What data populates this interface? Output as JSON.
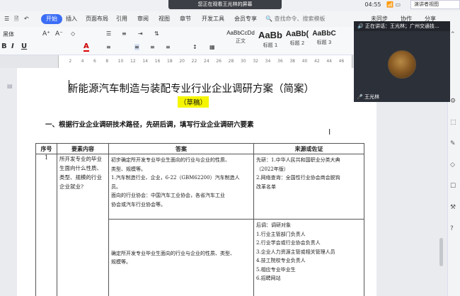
{
  "window": {
    "share_banner": "您正在观看王光林的屏幕",
    "time": "04:55",
    "presenter_view": "演讲者视图"
  },
  "menu": {
    "start": "开始",
    "items": [
      "插入",
      "页面布局",
      "引用",
      "审阅",
      "视图",
      "章节",
      "开发工具",
      "会员专享"
    ],
    "search": "查找命令、搜索模板",
    "right": [
      "未同步",
      "协作",
      "分享"
    ]
  },
  "ribbon": {
    "font_name": "黑体",
    "formats": [
      "B",
      "I",
      "U",
      "A"
    ],
    "styles": [
      {
        "sample": "AaBbCcDd",
        "name": "正文"
      },
      {
        "sample": "AaBb",
        "name": "标题 1"
      },
      {
        "sample": "AaBb(",
        "name": "标题 2"
      },
      {
        "sample": "AaBbC",
        "name": "标题 3"
      }
    ]
  },
  "ruler": {
    "numbers": [
      "2",
      "4",
      "6",
      "8",
      "10",
      "12",
      "14",
      "16",
      "18",
      "20",
      "22",
      "24",
      "26",
      "28",
      "30",
      "32",
      "34",
      "36",
      "38",
      "40",
      "42",
      "44",
      "46"
    ]
  },
  "doc": {
    "title": "新能源汽车制造与装配专业行业企业调研方案（简案）",
    "draft": "（草稿）",
    "section_heading": "一、根据行业企业调研技术路径，先研后调，填写行业企业调研六要素",
    "table": {
      "headers": [
        "序号",
        "要素内容",
        "答案",
        "来源或佐证"
      ],
      "row_no": "1",
      "requirement": "所开发专业的毕业生面向什么性质、类型、规模的行业企业就业?",
      "answer_top": [
        "初步确定所开发专业毕业生面向的行业与企业的性质、",
        "类型、规模等。",
        "1.汽车制造行业、企业，6-22（GBM62200）汽车制造人",
        "员。",
        "面向的行业协会：中国汽车工业协会，各省汽车工业",
        "协会或汽车行业协会等。"
      ],
      "answer_bottom": [
        "确定所开发专业毕业生面向的行业与企业的性质、类型、",
        "规模等。"
      ],
      "source_top": [
        "先研：1.中华人民共和国职业分类大典",
        "（2022年版）",
        "2.网络查询：全国性行业协会商会脱钩",
        "改革名单"
      ],
      "source_bottom": [
        "后调：调研对象",
        "1.行业主管部门负责人",
        "2.行业学会或行业协会负责人",
        "3.企业人力资源主管或相关管理人员",
        "4.技工院校专业负责人",
        "5.相应专业毕业生",
        "6.招聘网站"
      ]
    }
  },
  "video": {
    "speaking": "正在讲话：王光林；广州交通技...",
    "name": "王光林"
  }
}
